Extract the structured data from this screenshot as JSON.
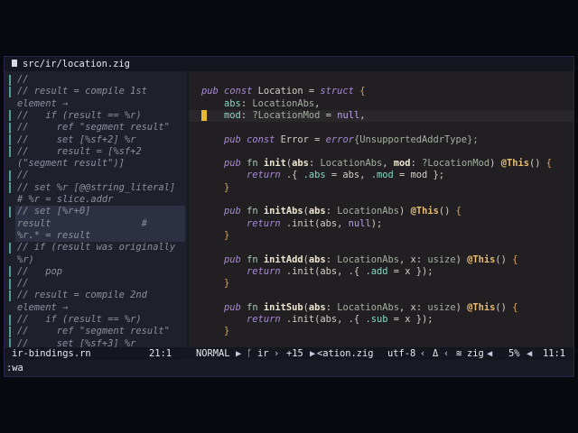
{
  "tab": {
    "icon": "file-icon",
    "title": "src/ir/location.zig"
  },
  "left_pane": {
    "lines": [
      {
        "text": "//",
        "bar": true
      },
      {
        "text": "// result = compile 1st",
        "bar": true
      },
      {
        "text": "element →",
        "bar": false
      },
      {
        "text": "//   if (result == %r)",
        "bar": true
      },
      {
        "text": "//     ref \"segment result\"",
        "bar": true
      },
      {
        "text": "//     set [%sf+2] %r",
        "bar": true
      },
      {
        "text": "//     result = [%sf+2",
        "bar": true
      },
      {
        "text": "(\"segment result\")]",
        "bar": false
      },
      {
        "text": "//",
        "bar": true
      },
      {
        "text": "// set %r [@@string_literal]",
        "bar": true
      },
      {
        "text": "# %r = slice.addr",
        "bar": false
      },
      {
        "text": "// set [%r+0]",
        "bar": true,
        "hl": true
      },
      {
        "text": "result                #",
        "bar": false,
        "hl": true
      },
      {
        "text": "%r.* = result",
        "bar": false,
        "hl": true
      },
      {
        "text": "// if (result was originally",
        "bar": true
      },
      {
        "text": "%r)",
        "bar": false
      },
      {
        "text": "//   pop",
        "bar": true
      },
      {
        "text": "//",
        "bar": true
      },
      {
        "text": "// result = compile 2nd",
        "bar": true
      },
      {
        "text": "element →",
        "bar": false
      },
      {
        "text": "//   if (result == %r)",
        "bar": true
      },
      {
        "text": "//     ref \"segment result\"",
        "bar": true
      },
      {
        "text": "//     set [%sf+3] %r",
        "bar": true
      }
    ],
    "status": {
      "file": "ir-bindings.rn",
      "position": "21:1"
    }
  },
  "right_pane": {
    "cursor_line": 3,
    "lines": [
      [],
      [
        [
          "pub",
          "k"
        ],
        [
          " ",
          "p"
        ],
        [
          "const",
          "k"
        ],
        [
          " Location = ",
          "p"
        ],
        [
          "struct",
          "k"
        ],
        [
          " {",
          "br"
        ]
      ],
      [
        [
          "    ",
          "p"
        ],
        [
          "abs",
          "fd"
        ],
        [
          ": ",
          "p"
        ],
        [
          "LocationAbs",
          "ty"
        ],
        [
          ",",
          "p"
        ]
      ],
      [
        [
          "    ",
          "p"
        ],
        [
          "mod",
          "fd"
        ],
        [
          ": ",
          "p"
        ],
        [
          "?LocationMod",
          "ty"
        ],
        [
          " = ",
          "p"
        ],
        [
          "null",
          "nl"
        ],
        [
          ",",
          "p"
        ]
      ],
      [],
      [
        [
          "    ",
          "p"
        ],
        [
          "pub",
          "k"
        ],
        [
          " ",
          "p"
        ],
        [
          "const",
          "k"
        ],
        [
          " Error = ",
          "p"
        ],
        [
          "error",
          "k"
        ],
        [
          "{UnsupportedAddrType};",
          "ty"
        ]
      ],
      [],
      [
        [
          "    ",
          "p"
        ],
        [
          "pub",
          "k"
        ],
        [
          " ",
          "p"
        ],
        [
          "fn",
          "f"
        ],
        [
          " ",
          "p"
        ],
        [
          "init",
          "n"
        ],
        [
          "(",
          "p"
        ],
        [
          "abs",
          "n"
        ],
        [
          ": ",
          "p"
        ],
        [
          "LocationAbs",
          "ty"
        ],
        [
          ", ",
          "p"
        ],
        [
          "mod",
          "n"
        ],
        [
          ": ",
          "p"
        ],
        [
          "?LocationMod",
          "ty"
        ],
        [
          ") ",
          "p"
        ],
        [
          "@This",
          "at"
        ],
        [
          "() ",
          "p"
        ],
        [
          "{",
          "br"
        ]
      ],
      [
        [
          "        ",
          "p"
        ],
        [
          "return",
          "k"
        ],
        [
          " .{ ",
          "p"
        ],
        [
          ".abs",
          "fd"
        ],
        [
          " = abs, ",
          "p"
        ],
        [
          ".mod",
          "fd"
        ],
        [
          " = mod };",
          "p"
        ]
      ],
      [
        [
          "    ",
          "p"
        ],
        [
          "}",
          "br"
        ]
      ],
      [],
      [
        [
          "    ",
          "p"
        ],
        [
          "pub",
          "k"
        ],
        [
          " ",
          "p"
        ],
        [
          "fn",
          "f"
        ],
        [
          " ",
          "p"
        ],
        [
          "initAbs",
          "n"
        ],
        [
          "(",
          "p"
        ],
        [
          "abs",
          "n"
        ],
        [
          ": ",
          "p"
        ],
        [
          "LocationAbs",
          "ty"
        ],
        [
          ") ",
          "p"
        ],
        [
          "@This",
          "at"
        ],
        [
          "() ",
          "p"
        ],
        [
          "{",
          "br"
        ]
      ],
      [
        [
          "        ",
          "p"
        ],
        [
          "return",
          "k"
        ],
        [
          " .init(abs, ",
          "p"
        ],
        [
          "null",
          "nl"
        ],
        [
          ");",
          "p"
        ]
      ],
      [
        [
          "    ",
          "p"
        ],
        [
          "}",
          "br"
        ]
      ],
      [],
      [
        [
          "    ",
          "p"
        ],
        [
          "pub",
          "k"
        ],
        [
          " ",
          "p"
        ],
        [
          "fn",
          "f"
        ],
        [
          " ",
          "p"
        ],
        [
          "initAdd",
          "n"
        ],
        [
          "(",
          "p"
        ],
        [
          "abs",
          "n"
        ],
        [
          ": ",
          "p"
        ],
        [
          "LocationAbs",
          "ty"
        ],
        [
          ", x: ",
          "p"
        ],
        [
          "usize",
          "ty"
        ],
        [
          ") ",
          "p"
        ],
        [
          "@This",
          "at"
        ],
        [
          "() ",
          "p"
        ],
        [
          "{",
          "br"
        ]
      ],
      [
        [
          "        ",
          "p"
        ],
        [
          "return",
          "k"
        ],
        [
          " .init(abs, .{ ",
          "p"
        ],
        [
          ".add",
          "fd"
        ],
        [
          " = x });",
          "p"
        ]
      ],
      [
        [
          "    ",
          "p"
        ],
        [
          "}",
          "br"
        ]
      ],
      [],
      [
        [
          "    ",
          "p"
        ],
        [
          "pub",
          "k"
        ],
        [
          " ",
          "p"
        ],
        [
          "fn",
          "f"
        ],
        [
          " ",
          "p"
        ],
        [
          "initSub",
          "n"
        ],
        [
          "(",
          "p"
        ],
        [
          "abs",
          "n"
        ],
        [
          ": ",
          "p"
        ],
        [
          "LocationAbs",
          "ty"
        ],
        [
          ", x: ",
          "p"
        ],
        [
          "usize",
          "ty"
        ],
        [
          ") ",
          "p"
        ],
        [
          "@This",
          "at"
        ],
        [
          "() ",
          "p"
        ],
        [
          "{",
          "br"
        ]
      ],
      [
        [
          "        ",
          "p"
        ],
        [
          "return",
          "k"
        ],
        [
          " .init(abs, .{ ",
          "p"
        ],
        [
          ".sub",
          "fd"
        ],
        [
          " = x });",
          "p"
        ]
      ],
      [
        [
          "    ",
          "p"
        ],
        [
          "}",
          "br"
        ]
      ],
      []
    ],
    "status": {
      "mode": "NORMAL",
      "branch": "ir",
      "changes": "+15",
      "file": "<ation.zig",
      "encoding": "utf-8",
      "diff": "Δ",
      "filetype": "zig",
      "percent": "5%",
      "position": "11:1"
    }
  },
  "command_line": ":wa"
}
